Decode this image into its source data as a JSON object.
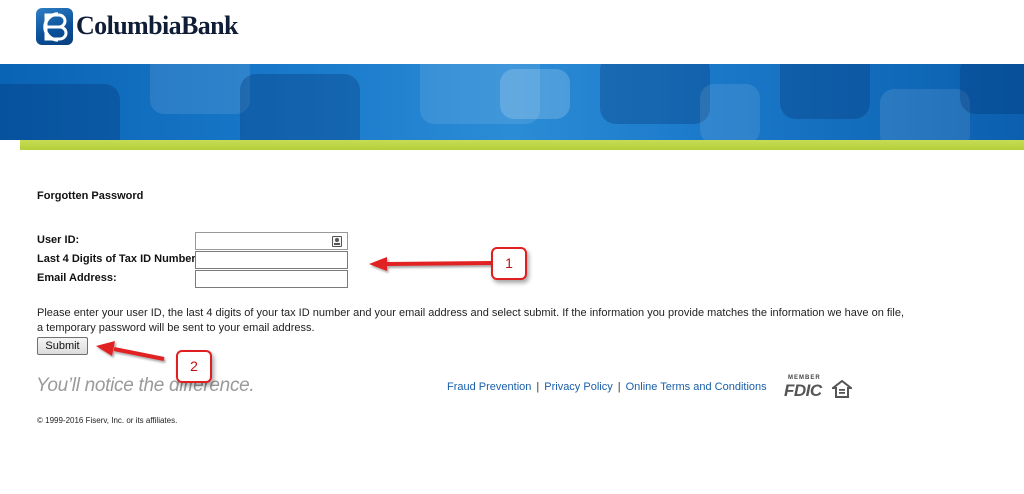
{
  "brand": {
    "name": "ColumbiaBank"
  },
  "page": {
    "title": "Forgotten Password"
  },
  "form": {
    "user_id_label": "User ID:",
    "tax_id_label": "Last 4 Digits of Tax ID Number:",
    "email_label": "Email Address:",
    "user_id_value": "",
    "tax_id_value": "",
    "email_value": "",
    "instructions": "Please enter your user ID, the last 4 digits of your tax ID number and your email address and select submit. If the information you provide matches the information we have on file, a temporary password will be sent to your email address.",
    "submit_label": "Submit"
  },
  "footer": {
    "tagline": "You’ll notice the difference.",
    "links": [
      "Fraud Prevention",
      "Privacy Policy",
      "Online Terms and Conditions"
    ],
    "separator": "|",
    "fdic_member": "MEMBER",
    "fdic_text": "FDIC",
    "copyright": "© 1999-2016 Fiserv, Inc. or its affiliates."
  },
  "annotations": {
    "one": "1",
    "two": "2"
  },
  "colors": {
    "banner_blue": "#1a78c9",
    "accent_green": "#b3cf39",
    "link_blue": "#1a5fa8",
    "annotation_red": "#e02020"
  }
}
